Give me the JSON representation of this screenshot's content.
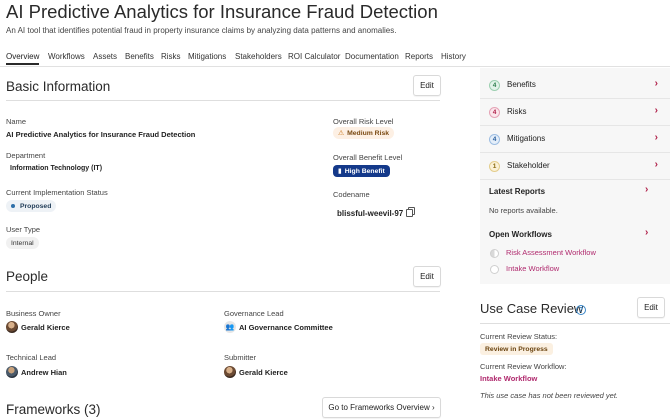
{
  "header": {
    "title": "AI Predictive Analytics for Insurance Fraud Detection",
    "description": "An AI tool that identifies potential fraud in property insurance claims by analyzing data patterns and anomalies."
  },
  "tabs": [
    {
      "label": "Overview",
      "active": true
    },
    {
      "label": "Workflows"
    },
    {
      "label": "Assets"
    },
    {
      "label": "Benefits"
    },
    {
      "label": "Risks"
    },
    {
      "label": "Mitigations"
    },
    {
      "label": "Stakeholders"
    },
    {
      "label": "ROI Calculator"
    },
    {
      "label": "Documentation"
    },
    {
      "label": "Reports"
    },
    {
      "label": "History"
    }
  ],
  "basic_info": {
    "title": "Basic Information",
    "edit_label": "Edit",
    "name_label": "Name",
    "name_value": "AI Predictive Analytics for Insurance Fraud Detection",
    "department_label": "Department",
    "department_value": "Information Technology (IT)",
    "status_label": "Current Implementation Status",
    "status_value": "Proposed",
    "user_type_label": "User Type",
    "user_type_value": "Internal",
    "risk_label": "Overall Risk Level",
    "risk_value": "Medium Risk",
    "benefit_label": "Overall Benefit Level",
    "benefit_value": "High Benefit",
    "codename_label": "Codename",
    "codename_value": "blissful-weevil-97"
  },
  "people": {
    "title": "People",
    "edit_label": "Edit",
    "business_owner_label": "Business Owner",
    "business_owner_value": "Gerald Kierce",
    "governance_lead_label": "Governance Lead",
    "governance_lead_value": "AI Governance Committee",
    "technical_lead_label": "Technical Lead",
    "technical_lead_value": "Andrew Hian",
    "submitter_label": "Submitter",
    "submitter_value": "Gerald Kierce"
  },
  "frameworks": {
    "title": "Frameworks (3)",
    "button_label": "Go to Frameworks Overview ›"
  },
  "sidebar": {
    "summary": [
      {
        "count": "4",
        "label": "Benefits",
        "color": "#2f7d4e",
        "bg": "#e3f3ea"
      },
      {
        "count": "4",
        "label": "Risks",
        "color": "#b0224b",
        "bg": "#fbe6ec"
      },
      {
        "count": "4",
        "label": "Mitigations",
        "color": "#2a5f9e",
        "bg": "#e4eef9"
      },
      {
        "count": "1",
        "label": "Stakeholder",
        "color": "#8a6a10",
        "bg": "#fbf1d6"
      }
    ],
    "latest_reports_label": "Latest Reports",
    "no_reports_text": "No reports available.",
    "open_workflows_label": "Open Workflows",
    "workflows": [
      "Risk Assessment Workflow",
      "Intake Workflow"
    ]
  },
  "review": {
    "title": "Use Case Review",
    "edit_label": "Edit",
    "status_label": "Current Review Status:",
    "status_value": "Review in Progress",
    "workflow_label": "Current Review Workflow:",
    "workflow_value": "Intake Workflow",
    "note": "This use case has not been reviewed yet."
  }
}
